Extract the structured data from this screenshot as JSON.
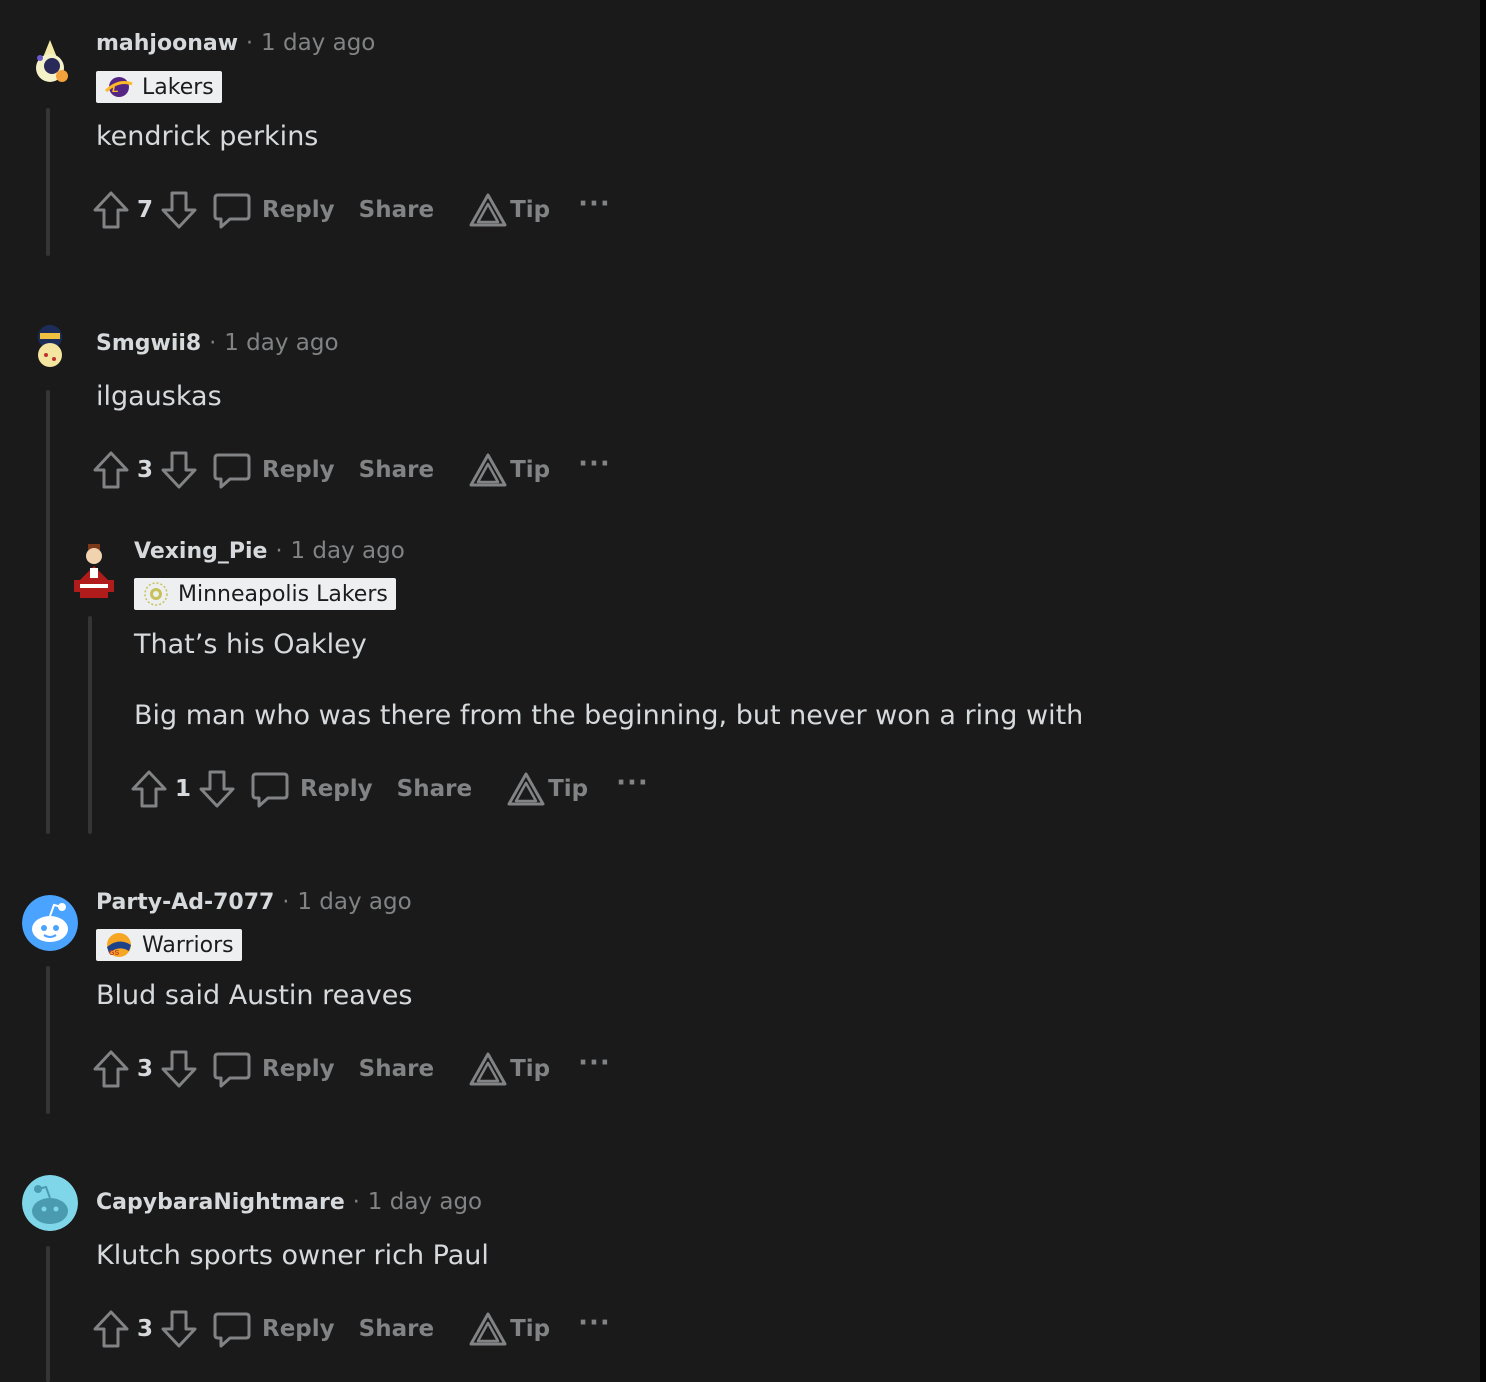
{
  "comments": [
    {
      "user": "mahjoonaw",
      "time": "1 day ago",
      "flair": "Lakers",
      "body": [
        "kendrick perkins"
      ],
      "score": "7"
    },
    {
      "user": "Smgwii8",
      "time": "1 day ago",
      "body": [
        "ilgauskas"
      ],
      "score": "3"
    },
    {
      "user": "Vexing_Pie",
      "time": "1 day ago",
      "flair": "Minneapolis Lakers",
      "body": [
        "That’s his Oakley",
        "Big man who was there from the beginning, but never won a ring with"
      ],
      "score": "1"
    },
    {
      "user": "Party-Ad-7077",
      "time": "1 day ago",
      "flair": "Warriors",
      "body": [
        "Blud said Austin reaves"
      ],
      "score": "3"
    },
    {
      "user": "CapybaraNightmare",
      "time": "1 day ago",
      "body": [
        "Klutch sports owner rich Paul"
      ],
      "score": "3"
    }
  ],
  "actions": {
    "reply": "Reply",
    "share": "Share",
    "tip": "Tip",
    "more": "···",
    "separator": "·"
  },
  "colors": {
    "background": "#1a1a1b",
    "text": "#d7dadc",
    "muted": "#818384",
    "flair_bg": "#edeff1",
    "thread_line": "#343536"
  }
}
